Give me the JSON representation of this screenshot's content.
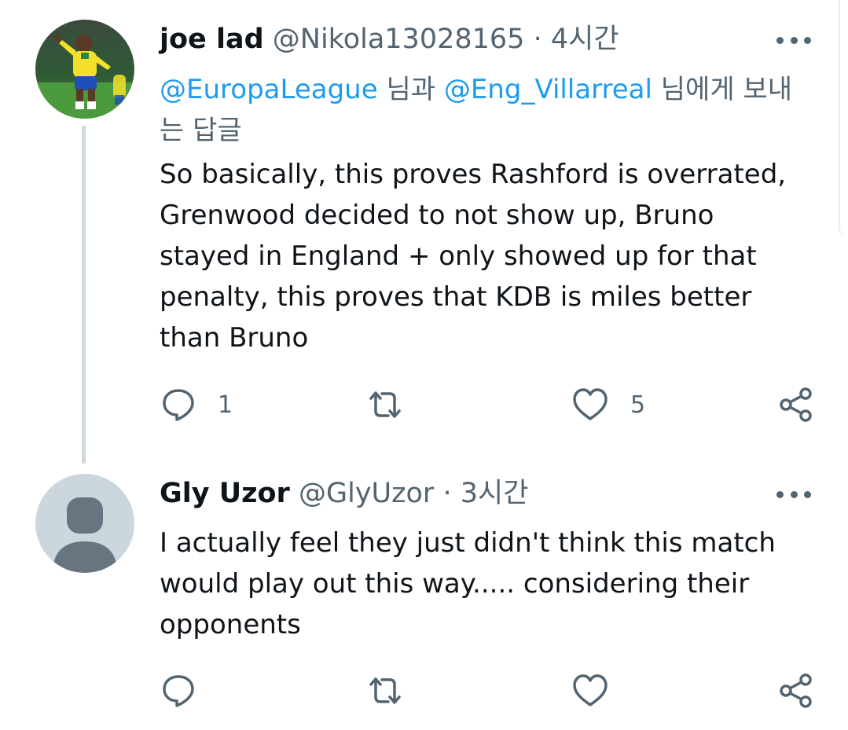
{
  "tweets": [
    {
      "display_name": "joe lad",
      "handle": "@Nikola13028165",
      "separator": "·",
      "time": "4시간",
      "reply_to": {
        "mention1": "@EuropaLeague",
        "joiner": "님과",
        "mention2": "@Eng_Villarreal",
        "suffix": "님에게 보내는 답글"
      },
      "text": "So basically, this proves Rashford is overrated, Grenwood decided to not show up, Bruno stayed in England + only showed up for that penalty, this proves that KDB is miles better than Bruno",
      "reply_count": "1",
      "retweet_count": "",
      "like_count": "5"
    },
    {
      "display_name": "Gly Uzor",
      "handle": "@GlyUzor",
      "separator": "·",
      "time": "3시간",
      "text": "I actually feel they just didn't think this match would play out this way..... considering their opponents",
      "reply_count": "",
      "retweet_count": "",
      "like_count": ""
    }
  ],
  "icons": {
    "more": "more-horizontal-icon",
    "reply": "reply-bubble-icon",
    "retweet": "retweet-icon",
    "like": "heart-icon",
    "share": "share-icon"
  },
  "colors": {
    "text": "#0f1419",
    "secondary": "#536471",
    "link": "#1d9bf0",
    "thread_line": "#cfd9de",
    "default_avatar_bg": "#ccd6dd",
    "default_avatar_fg": "#66757f"
  }
}
